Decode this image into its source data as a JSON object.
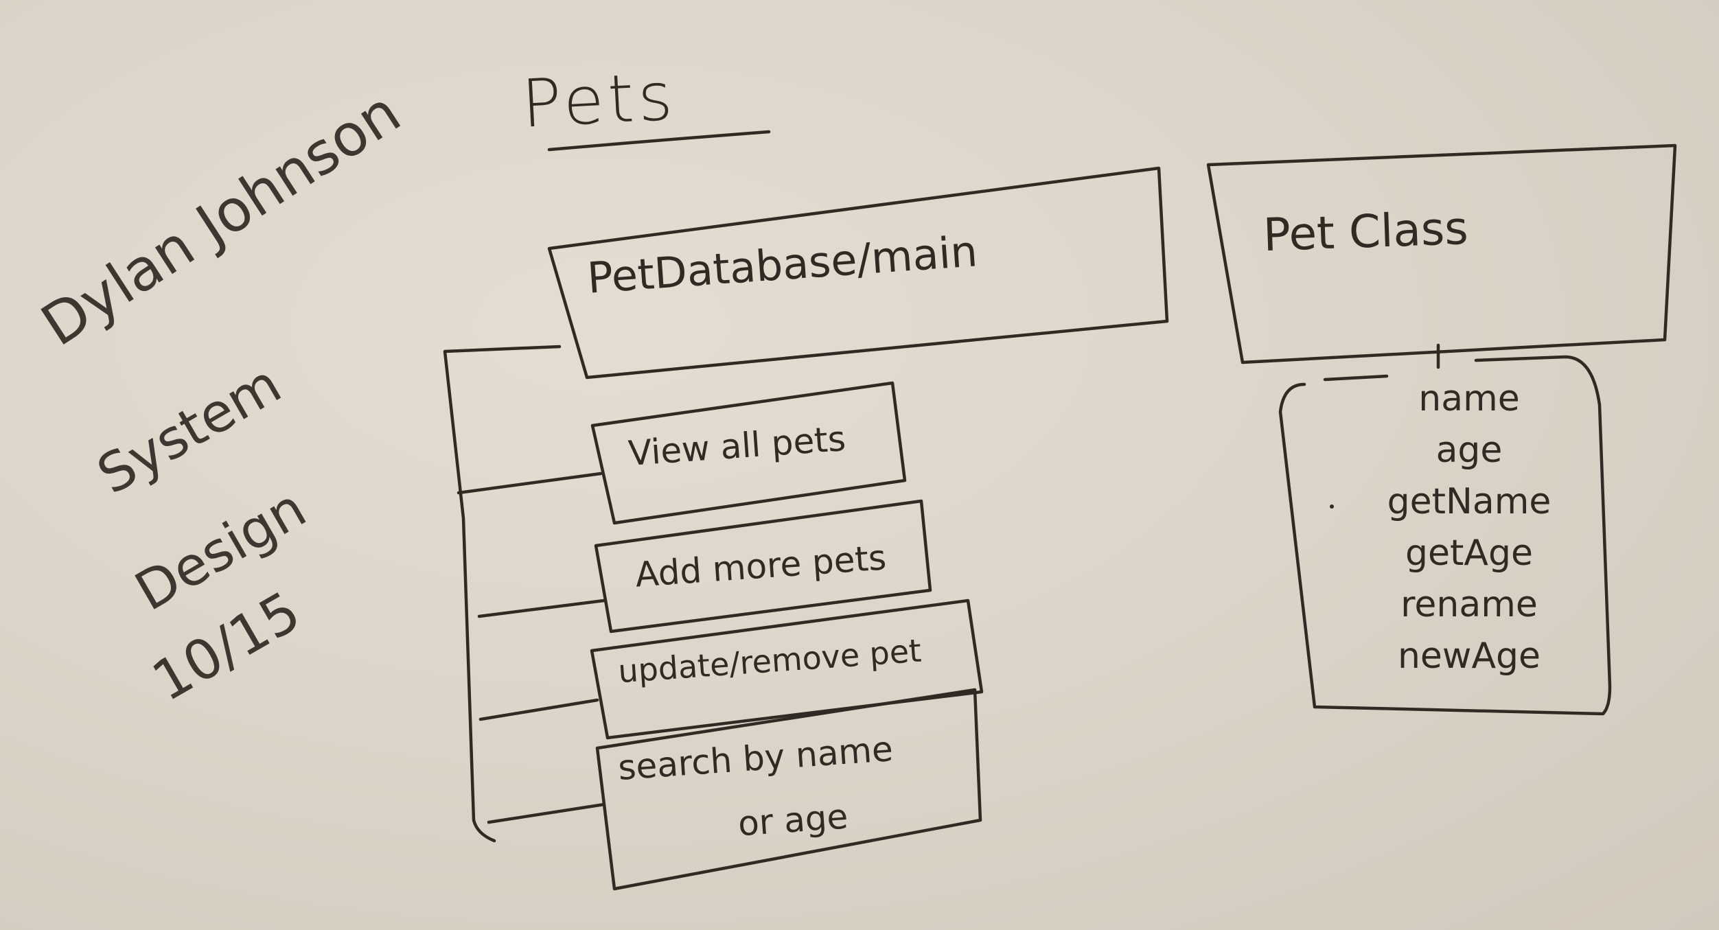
{
  "title": "Pets",
  "author": "Dylan Johnson",
  "subtitle": [
    "System",
    "Design"
  ],
  "date": "10/15",
  "main_box": {
    "label": "PetDatabase/main",
    "functions": [
      "View all pets",
      "Add more pets",
      "update/remove pet",
      "search by name",
      "or age"
    ]
  },
  "class_box": {
    "label": "Pet Class",
    "attributes": [
      "name",
      "age",
      "getName",
      "getAge",
      "rename",
      "newAge"
    ]
  },
  "colors": {
    "board": "#ddd5c9",
    "marker": "#2f2a23"
  }
}
